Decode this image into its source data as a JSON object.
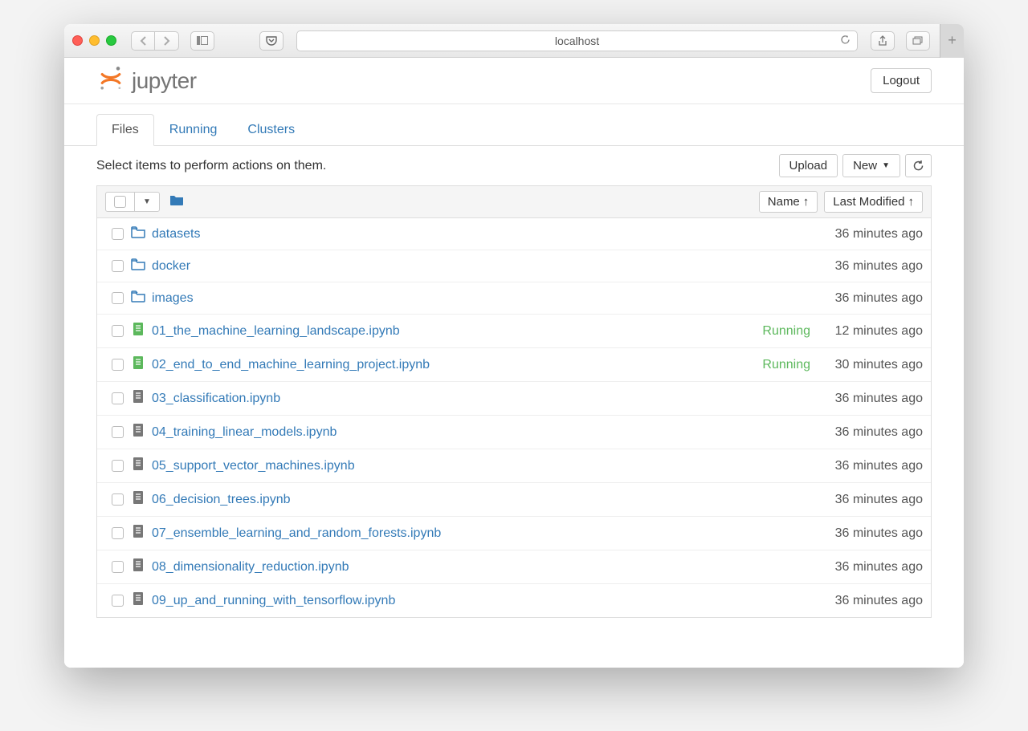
{
  "browser": {
    "url": "localhost"
  },
  "header": {
    "brand": "jupyter",
    "logout": "Logout"
  },
  "tabs": {
    "files": "Files",
    "running": "Running",
    "clusters": "Clusters"
  },
  "toolbar": {
    "hint": "Select items to perform actions on them.",
    "upload": "Upload",
    "new_menu": "New"
  },
  "list_header": {
    "sort_name": "Name",
    "sort_modified": "Last Modified"
  },
  "files": [
    {
      "type": "folder",
      "name": "datasets",
      "modified": "36 minutes ago"
    },
    {
      "type": "folder",
      "name": "docker",
      "modified": "36 minutes ago"
    },
    {
      "type": "folder",
      "name": "images",
      "modified": "36 minutes ago"
    },
    {
      "type": "notebook",
      "name": "01_the_machine_learning_landscape.ipynb",
      "status": "Running",
      "modified": "12 minutes ago"
    },
    {
      "type": "notebook",
      "name": "02_end_to_end_machine_learning_project.ipynb",
      "status": "Running",
      "modified": "30 minutes ago"
    },
    {
      "type": "notebook",
      "name": "03_classification.ipynb",
      "modified": "36 minutes ago"
    },
    {
      "type": "notebook",
      "name": "04_training_linear_models.ipynb",
      "modified": "36 minutes ago"
    },
    {
      "type": "notebook",
      "name": "05_support_vector_machines.ipynb",
      "modified": "36 minutes ago"
    },
    {
      "type": "notebook",
      "name": "06_decision_trees.ipynb",
      "modified": "36 minutes ago"
    },
    {
      "type": "notebook",
      "name": "07_ensemble_learning_and_random_forests.ipynb",
      "modified": "36 minutes ago"
    },
    {
      "type": "notebook",
      "name": "08_dimensionality_reduction.ipynb",
      "modified": "36 minutes ago"
    },
    {
      "type": "notebook",
      "name": "09_up_and_running_with_tensorflow.ipynb",
      "modified": "36 minutes ago"
    }
  ]
}
